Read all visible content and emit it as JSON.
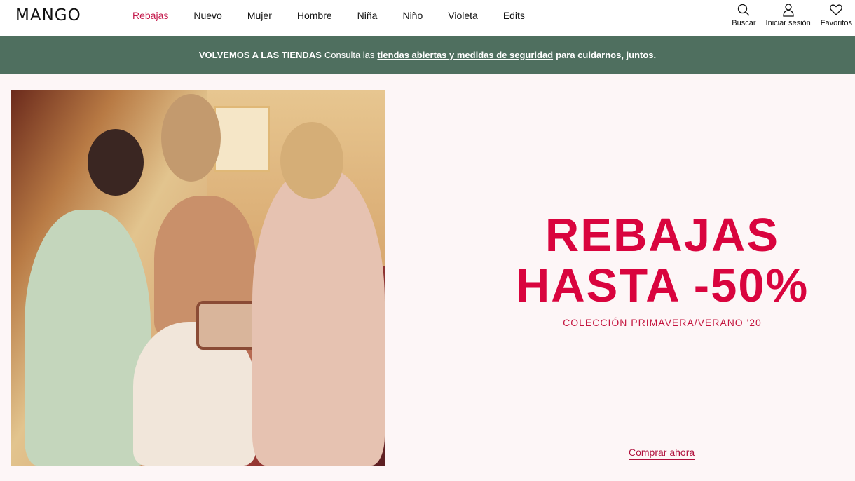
{
  "header": {
    "logo": "MANGO",
    "nav": [
      {
        "label": "Rebajas",
        "active": true
      },
      {
        "label": "Nuevo"
      },
      {
        "label": "Mujer"
      },
      {
        "label": "Hombre"
      },
      {
        "label": "Niña"
      },
      {
        "label": "Niño"
      },
      {
        "label": "Violeta"
      },
      {
        "label": "Edits"
      }
    ],
    "tools": {
      "search": {
        "label": "Buscar",
        "icon": "search-icon"
      },
      "login": {
        "label": "Iniciar sesión",
        "icon": "user-icon"
      },
      "favorites": {
        "label": "Favoritos",
        "icon": "heart-icon"
      }
    }
  },
  "banner": {
    "strong": "VOLVEMOS A LAS TIENDAS",
    "text": "Consulta las",
    "link": "tiendas abiertas y medidas de seguridad",
    "rest": "para cuidarnos, juntos."
  },
  "hero": {
    "title_line1": "REBAJAS",
    "title_line2": "HASTA -50%",
    "subtitle": "COLECCIÓN PRIMAVERA/VERANO '20",
    "cta": "Comprar ahora"
  },
  "colors": {
    "accent": "#d9043e",
    "nav_active": "#c4184b",
    "banner_bg": "#4f6f5f",
    "page_bg": "#fdf6f7"
  }
}
